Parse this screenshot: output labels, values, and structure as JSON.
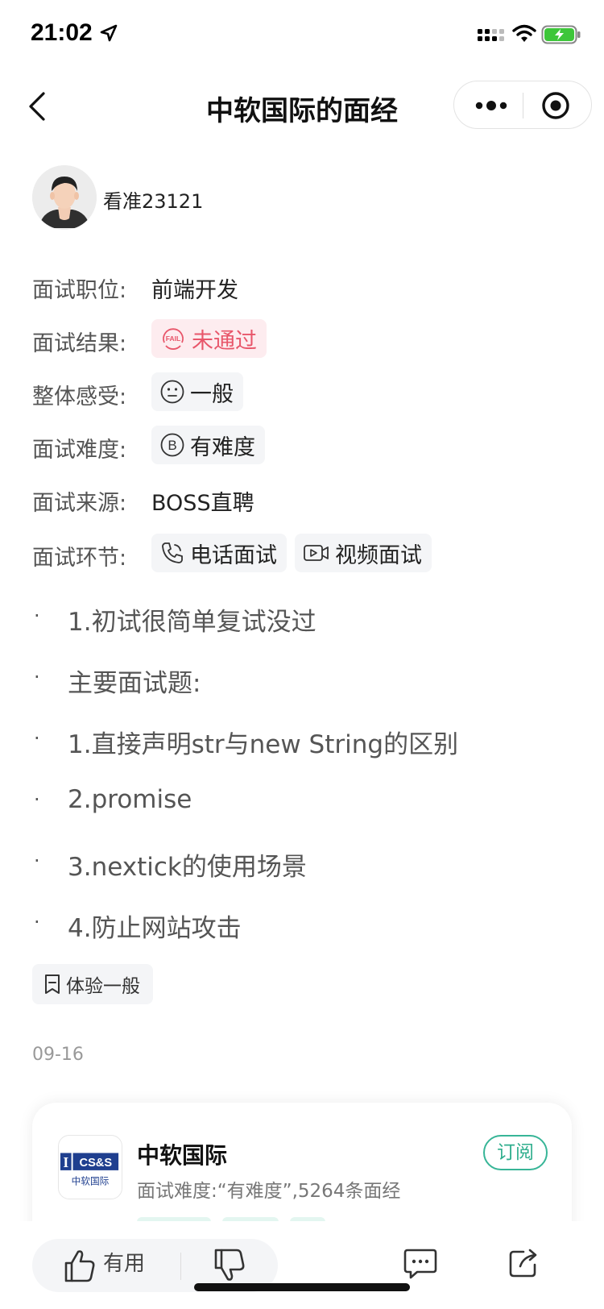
{
  "status_bar": {
    "time": "21:02"
  },
  "nav": {
    "title": "中软国际的面经"
  },
  "author": {
    "name": "看准23121"
  },
  "info": {
    "position_label": "面试职位:",
    "position_value": "前端开发",
    "result_label": "面试结果:",
    "result_value": "未通过",
    "result_badge": "FAIL",
    "feeling_label": "整体感受:",
    "feeling_value": "一般",
    "difficulty_label": "面试难度:",
    "difficulty_value": "有难度",
    "difficulty_badge": "B",
    "source_label": "面试来源:",
    "source_value": "BOSS直聘",
    "stage_label": "面试环节:",
    "stage_values": [
      "电话面试",
      "视频面试"
    ]
  },
  "content": {
    "bullet_char": "·",
    "lines": [
      "1.初试很简单复试没过",
      "主要面试题:",
      "1.直接声明str与new String的区别",
      "2.promise",
      "3.nextick的使用场景",
      "4.防止网站攻击"
    ]
  },
  "experience_tag": "体验一般",
  "date": "09-16",
  "company": {
    "name": "中软国际",
    "description": "面试难度:“有难度”,5264条面经",
    "subscribe_label": "订阅",
    "logo_text_top": "CS&S",
    "logo_text_bottom": "中软国际",
    "logo_letter": "I"
  },
  "bottom": {
    "useful_label": "有用"
  },
  "colors": {
    "fail_red": "#e8566a",
    "fail_bg": "#fdecef",
    "brand_green": "#2fae8d",
    "chip_bg": "#f4f5f7",
    "battery_green": "#3ec63a"
  }
}
